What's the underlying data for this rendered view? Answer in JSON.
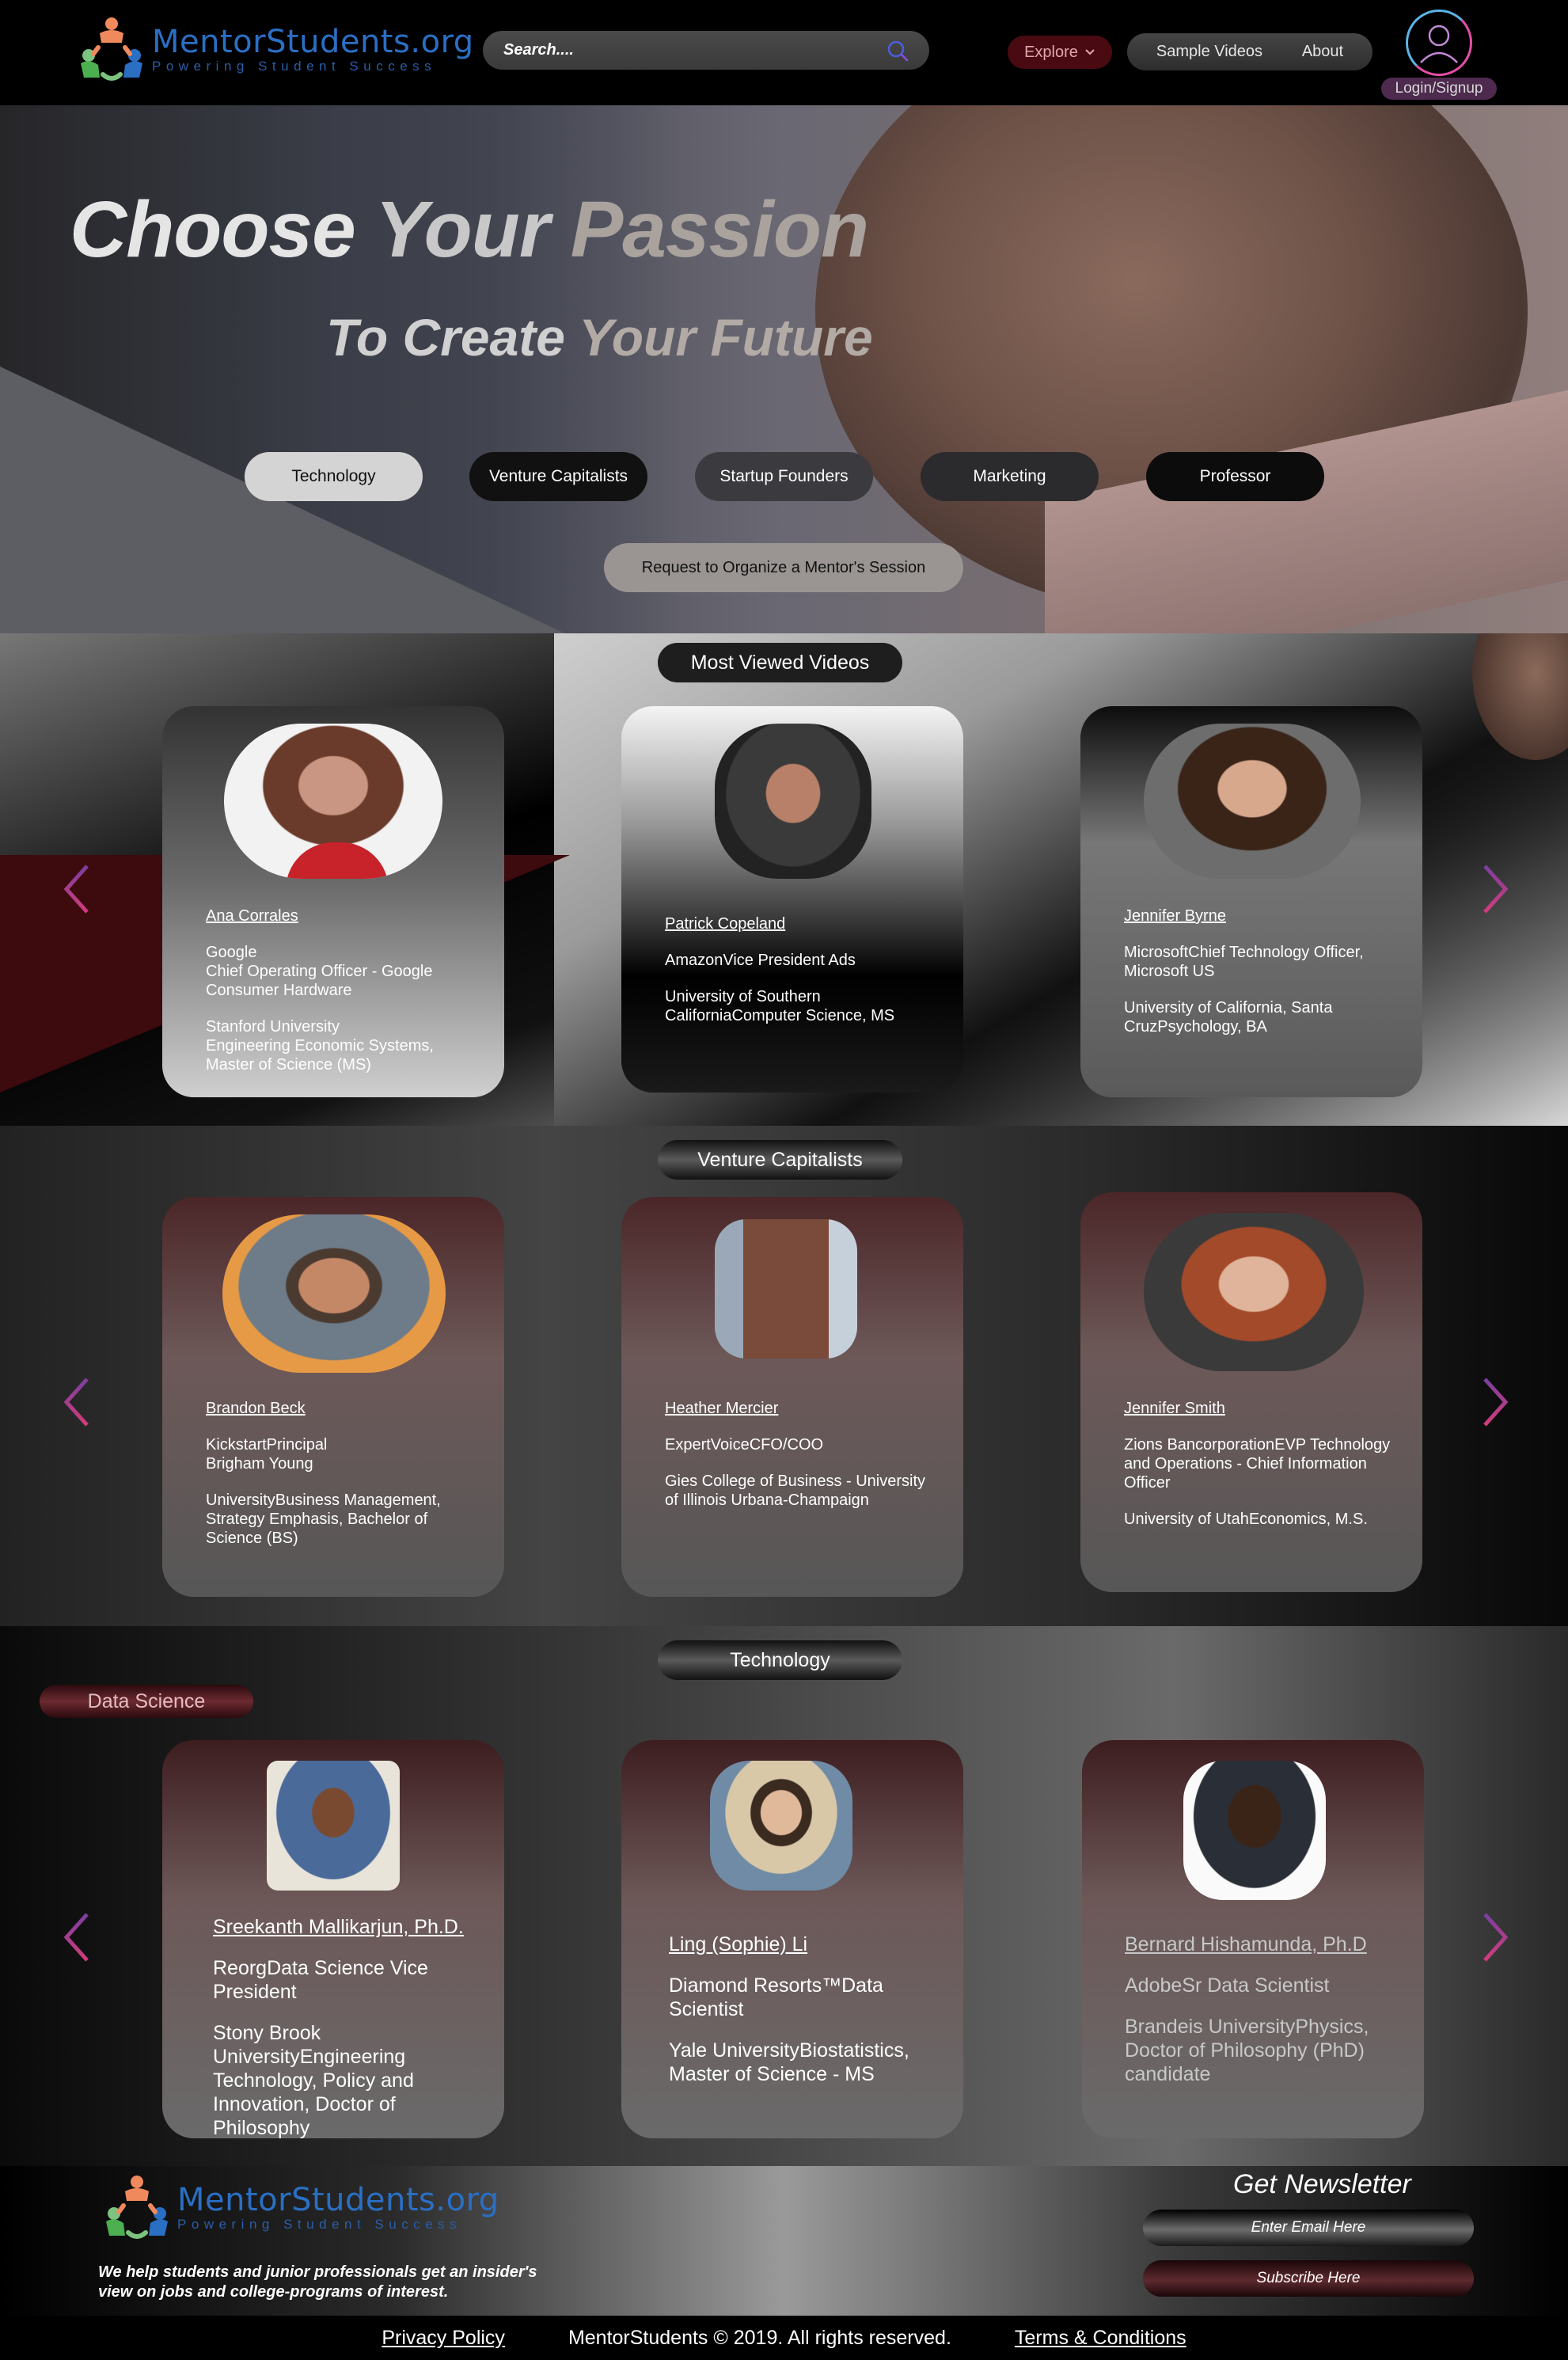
{
  "header": {
    "logo_title": "MentorStudents.org",
    "logo_tagline": "Powering Student Success",
    "search_placeholder": "Search....",
    "explore_label": "Explore",
    "nav": [
      "Sample Videos",
      "About"
    ],
    "login_label": "Login/Signup"
  },
  "hero": {
    "title_words": [
      "Choose",
      "Your",
      "Passion"
    ],
    "subtitle_words": [
      "To Create",
      "Your Future"
    ],
    "categories": [
      "Technology",
      "Venture Capitalists",
      "Startup Founders",
      "Marketing",
      "Professor"
    ],
    "request_label": "Request to Organize a Mentor's Session"
  },
  "sections": [
    {
      "title": "Most Viewed Videos",
      "cards": [
        {
          "name": "Ana Corrales",
          "company": "Google\nChief Operating Officer - Google Consumer Hardware",
          "education": "Stanford University\nEngineering Economic Systems, Master of Science (MS)"
        },
        {
          "name": "Patrick Copeland",
          "company": "AmazonVice President Ads",
          "education": "University of Southern CaliforniaComputer Science, MS"
        },
        {
          "name": "Jennifer Byrne",
          "company": "MicrosoftChief Technology Officer, Microsoft US",
          "education": "University of California, Santa CruzPsychology, BA"
        }
      ]
    },
    {
      "title": "Venture Capitalists",
      "cards": [
        {
          "name": "Brandon Beck",
          "company": "KickstartPrincipal\nBrigham Young",
          "education": "UniversityBusiness Management, Strategy Emphasis, Bachelor of Science (BS)"
        },
        {
          "name": "Heather Mercier",
          "company": "ExpertVoiceCFO/COO",
          "education": "Gies College of Business - University of Illinois Urbana-Champaign"
        },
        {
          "name": "Jennifer Smith",
          "company": "Zions BancorporationEVP Technology and Operations - Chief Information Officer",
          "education": "University of UtahEconomics, M.S."
        }
      ]
    },
    {
      "title": "Technology",
      "subcategory": "Data Science",
      "cards": [
        {
          "name": "Sreekanth Mallikarjun, Ph.D.",
          "company": "ReorgData Science Vice President",
          "education": "Stony Brook UniversityEngineering Technology, Policy and Innovation, Doctor of Philosophy"
        },
        {
          "name": "Ling (Sophie) Li",
          "company": "Diamond Resorts™Data Scientist",
          "education": "Yale UniversityBiostatistics, Master of Science - MS"
        },
        {
          "name": "Bernard Hishamunda, Ph.D",
          "company": "AdobeSr Data Scientist",
          "education": "Brandeis UniversityPhysics, Doctor of Philosophy (PhD) candidate"
        }
      ]
    }
  ],
  "footer": {
    "logo_title": "MentorStudents.org",
    "logo_tagline": "Powering Student Success",
    "description": "We help students and junior professionals get an insider's view on jobs and college-programs of interest.",
    "newsletter_title": "Get Newsletter",
    "email_placeholder": "Enter Email Here",
    "subscribe_label": "Subscribe Here",
    "privacy": "Privacy Policy",
    "copyright": "MentorStudents © 2019. All rights reserved.",
    "terms": "Terms & Conditions"
  },
  "colors": {
    "brand_blue": "#2a6fc4",
    "explore_red": "#4a0a12",
    "arrow_purple": "#7a3fa0",
    "arrow_pink": "#d23c7a"
  }
}
